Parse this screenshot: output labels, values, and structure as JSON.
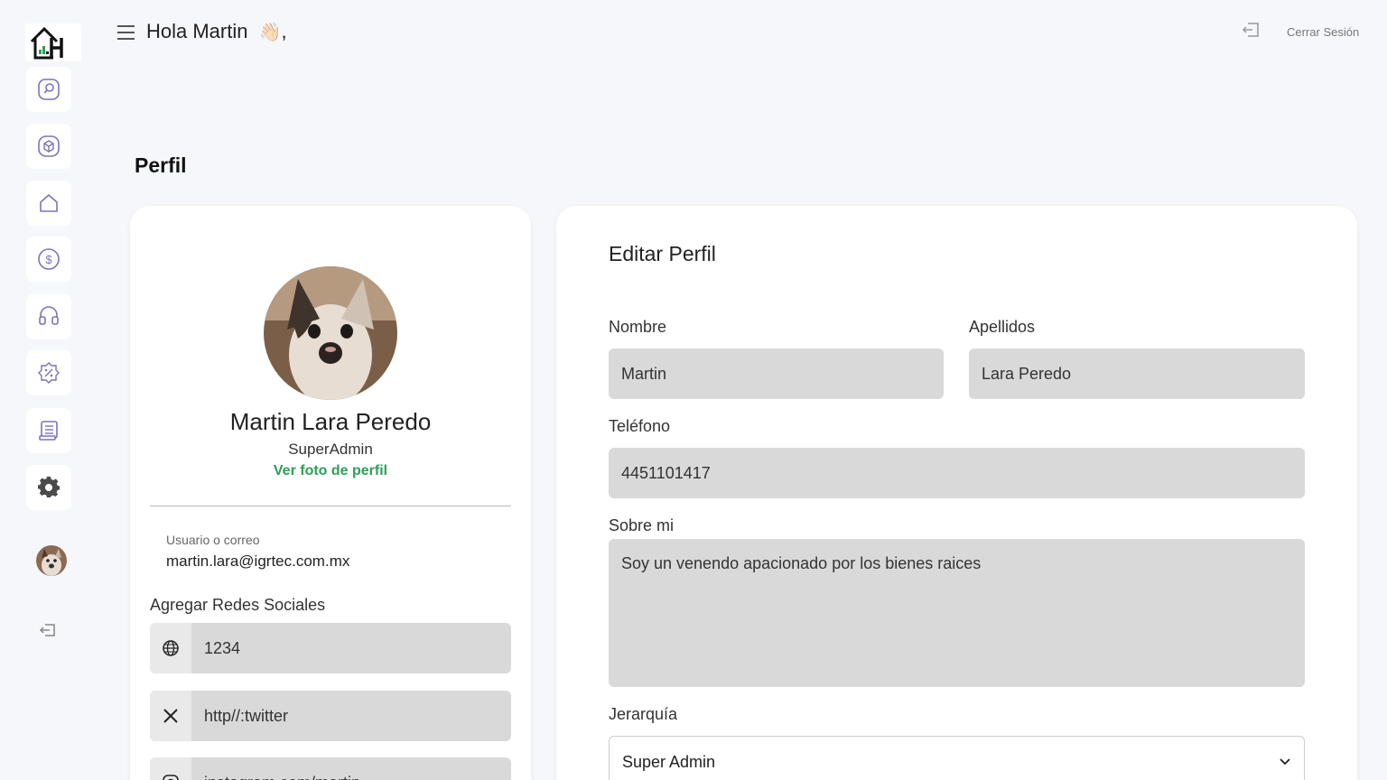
{
  "header": {
    "greeting": "Hola Martin",
    "greeting_suffix": ",",
    "logout_label": "Cerrar Sesión"
  },
  "sidebar": {
    "items": [
      {
        "icon": "search-icon"
      },
      {
        "icon": "box-icon"
      },
      {
        "icon": "home-icon"
      },
      {
        "icon": "dollar-icon"
      },
      {
        "icon": "headset-icon"
      },
      {
        "icon": "badge-percent-icon"
      },
      {
        "icon": "document-icon"
      },
      {
        "icon": "gear-icon"
      }
    ]
  },
  "page": {
    "title": "Perfil"
  },
  "profile": {
    "name": "Martin Lara Peredo",
    "role": "SuperAdmin",
    "view_photo": "Ver foto de perfil",
    "user_label": "Usuario o correo",
    "email": "martin.lara@igrtec.com.mx",
    "social_title": "Agregar Redes Sociales",
    "socials": [
      {
        "icon": "globe-icon",
        "value": "1234"
      },
      {
        "icon": "x-twitter-icon",
        "value": "http//:twitter"
      },
      {
        "icon": "instagram-icon",
        "value": "instagram.com/martin"
      }
    ]
  },
  "edit": {
    "title": "Editar Perfil",
    "nombre_label": "Nombre",
    "nombre_value": "Martin",
    "apellidos_label": "Apellidos",
    "apellidos_value": "Lara Peredo",
    "telefono_label": "Teléfono",
    "telefono_value": "4451101417",
    "sobre_label": "Sobre mi",
    "sobre_value": "Soy un venendo apacionado por los bienes raices",
    "jerarquia_label": "Jerarquía",
    "jerarquia_value": "Super Admin"
  },
  "colors": {
    "accent_green": "#2e9e5a",
    "field_bg": "#d9d9d9",
    "icon_purple": "#7b74b8"
  }
}
